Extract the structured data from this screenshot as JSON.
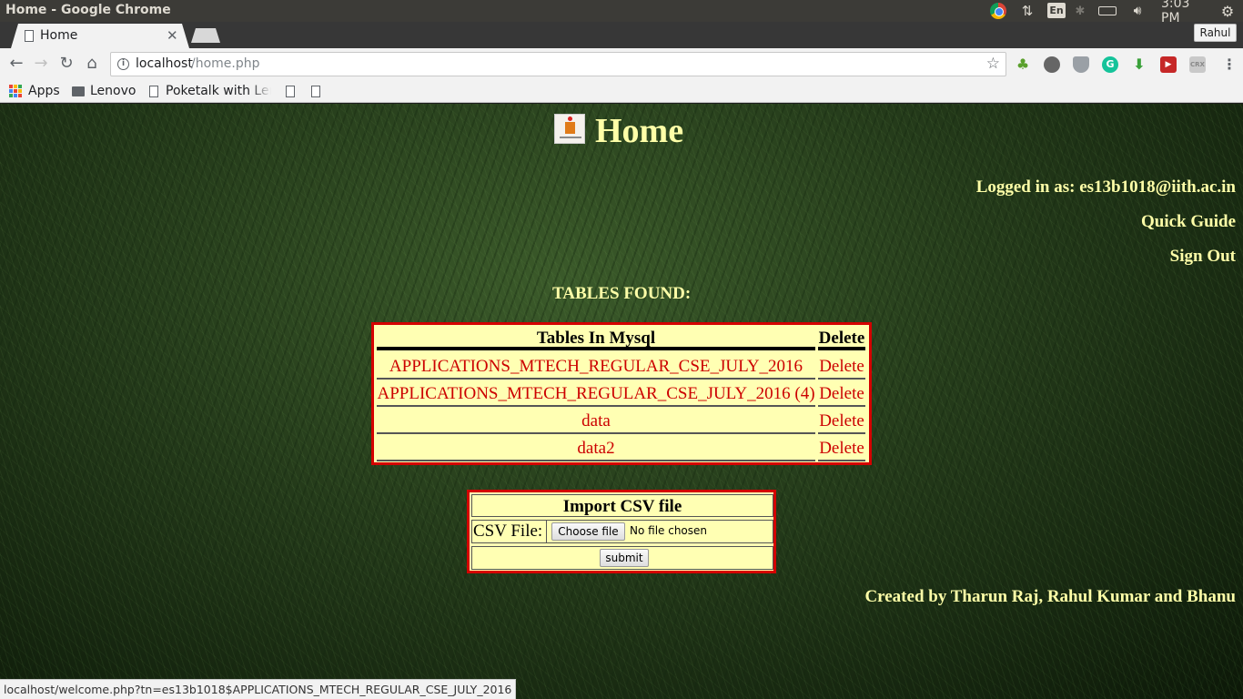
{
  "os": {
    "window_title": "Home - Google Chrome",
    "lang": "En",
    "clock": "3:03 PM"
  },
  "browser": {
    "tab_title": "Home",
    "profile": "Rahul",
    "url_host": "localhost",
    "url_path": "/home.php",
    "bookmarks": {
      "apps": "Apps",
      "lenovo": "Lenovo",
      "poketalk": "Poketalk with Lenovo"
    },
    "status_url": "localhost/welcome.php?tn=es13b1018$APPLICATIONS_MTECH_REGULAR_CSE_JULY_2016",
    "extension_icons": [
      "leaf-icon",
      "globe-icon",
      "shield-icon",
      "grammarly-icon",
      "download-icon",
      "ghostery-icon",
      "crx-icon"
    ],
    "crx_label": "CRX",
    "grammarly_label": "G"
  },
  "page": {
    "title": "Home",
    "logged_in": "Logged in as: es13b1018@iith.ac.in",
    "quick_guide": "Quick Guide",
    "sign_out": "Sign Out",
    "tables_found": "TABLES FOUND:",
    "table_headers": {
      "name": "Tables In Mysql",
      "delete": "Delete"
    },
    "tables": [
      {
        "name": "APPLICATIONS_MTECH_REGULAR_CSE_JULY_2016",
        "delete": "Delete"
      },
      {
        "name": "APPLICATIONS_MTECH_REGULAR_CSE_JULY_2016 (4)",
        "delete": "Delete"
      },
      {
        "name": "data",
        "delete": "Delete"
      },
      {
        "name": "data2",
        "delete": "Delete"
      }
    ],
    "import": {
      "heading": "Import CSV file",
      "file_label": "CSV File:",
      "choose_button": "Choose file",
      "no_file": "No file chosen",
      "submit": "submit"
    },
    "credits": "Created by Tharun Raj, Rahul Kumar and Bhanu"
  },
  "colors": {
    "accent_text": "#ffffa8",
    "table_bg": "#ffffb3",
    "table_border": "#d40000",
    "link_red": "#cc0000"
  }
}
